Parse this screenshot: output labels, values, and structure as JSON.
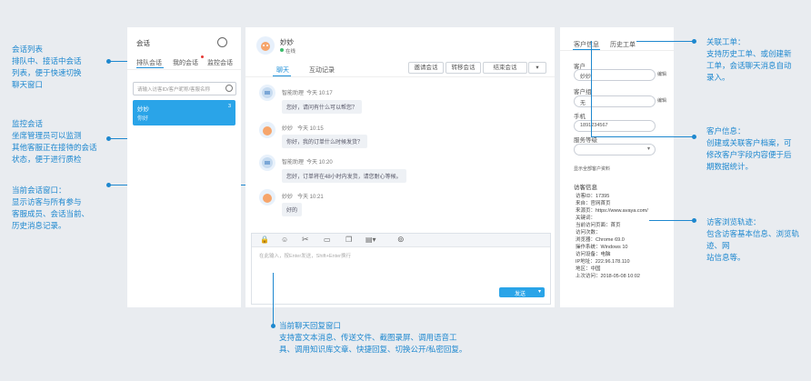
{
  "left_annotations": {
    "session_list": {
      "title": "会话列表",
      "desc1": "排队中、接话中会话",
      "desc2": "列表，便于快速切换",
      "desc3": "聊天窗口"
    },
    "monitor": {
      "title": "监控会话",
      "desc1": "坐席管理员可以监测",
      "desc2": "其他客服正在接待的会话",
      "desc3": "状态，便于进行质检"
    },
    "current_window": {
      "title": "当前会话窗口：",
      "desc1": "显示访客与所有参与",
      "desc2": "客服成员、会话当前、",
      "desc3": "历史消息记录。"
    }
  },
  "session_panel": {
    "title": "会话",
    "tabs": [
      "排队会话",
      "我的会话",
      "监控会话"
    ],
    "search_placeholder": "请输入访客ID/客户昵称/客服名称",
    "active_item": {
      "name": "妙妙",
      "sub": "你好",
      "badge": "3"
    }
  },
  "chat": {
    "title": "妙妙",
    "status": "在线",
    "tabs": [
      "聊天",
      "互动记录"
    ],
    "actions": [
      "邀请会话",
      "转移会话",
      "结束会话"
    ],
    "messages": [
      {
        "name": "智能助理",
        "time": "今天 10:17",
        "text": "您好，请问有什么可以帮您？"
      },
      {
        "name": "妙妙",
        "time": "今天 10:15",
        "text": "你好，我的订单什么时候发货？"
      },
      {
        "name": "智能助理",
        "time": "今天 10:20",
        "text": "您好，订单将在48小时内发货，请您耐心等候。"
      },
      {
        "name": "妙妙",
        "time": "今天 10:21",
        "text": "好的"
      }
    ],
    "input_placeholder": "在此输入，按Enter发送，Shift+Enter换行",
    "send_label": "发送"
  },
  "bottom_annotation": {
    "title": "当前聊天回复窗口",
    "desc1": "支持富文本消息、传送文件、截图录屏、调用语音工",
    "desc2": "具、调用知识库文章、快捷回复、切换公开/私密回复。"
  },
  "customer": {
    "tabs": [
      "客户信息",
      "历史工单"
    ],
    "fields": [
      {
        "label": "客户",
        "value": "妙妙",
        "link": "编辑"
      },
      {
        "label": "客户组",
        "value": "无",
        "link": "编辑"
      },
      {
        "label": "手机",
        "value": "1891234567"
      },
      {
        "label": "服务等级",
        "value": ""
      }
    ],
    "extra_link": "显示全部客户资料",
    "visitor_title": "访客信息",
    "visitor_rows": [
      "访客ID：17395",
      "来自：官网首页",
      "来源页：https://www.avaya.com/",
      "关键词：",
      "当前访问页面：首页",
      "访问次数：",
      "浏览器：Chrome 69.0",
      "操作系统：Windows 10",
      "访问设备：电脑",
      "IP地址：222.96.178.110",
      "地区：中国",
      "上次访问：2018-05-08 10:02"
    ]
  },
  "right_annotations": {
    "related_tickets": {
      "title": "关联工单：",
      "desc1": "支持历史工单、或创建新",
      "desc2": "工单，会话聊天消息自动",
      "desc3": "录入。"
    },
    "customer_info": {
      "title": "客户信息：",
      "desc1": "创建或关联客户档案，可",
      "desc2": "修改客户字段内容便于后",
      "desc3": "期数据统计。"
    },
    "visitor_track": {
      "title": "访客浏览轨迹：",
      "desc1": "包含访客基本信息、浏览轨迹、网",
      "desc2": "站信息等。"
    }
  }
}
